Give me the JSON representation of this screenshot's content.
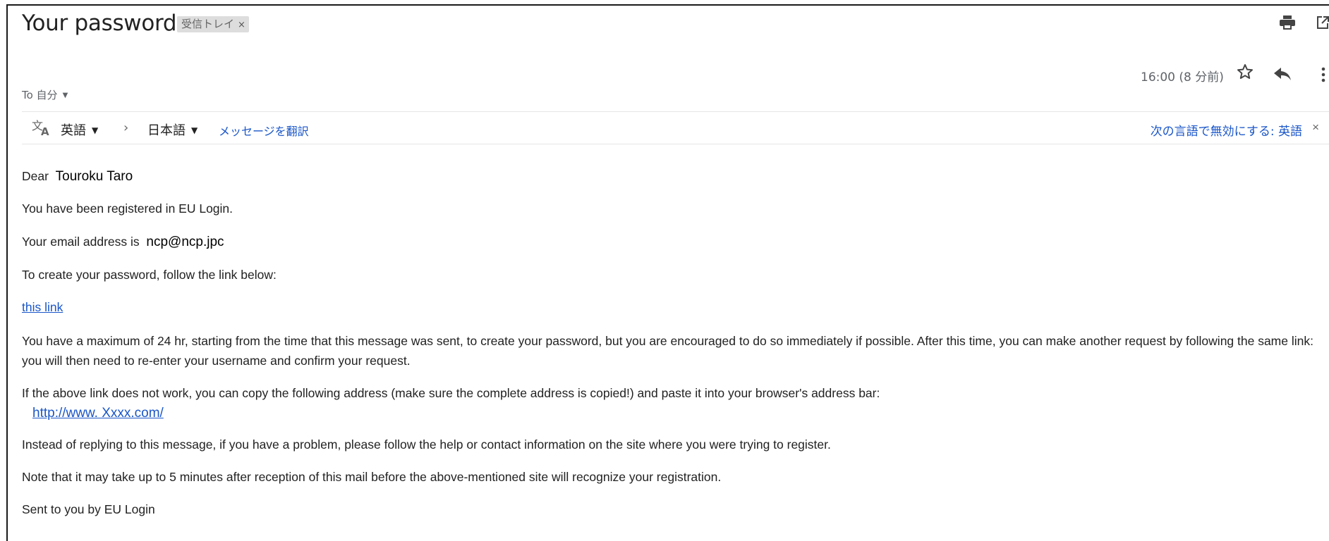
{
  "email": {
    "subject": "Your password",
    "label": "受信トレイ",
    "label_close": "×",
    "time": "16:00 (8 分前)",
    "to_label": "To 自分"
  },
  "translate": {
    "from_language": "英語",
    "to_language": "日本語",
    "translate_link": "メッセージを翻訳",
    "disable_link": "次の言語で無効にする: 英語",
    "close": "×"
  },
  "body": {
    "greeting": "Dear",
    "recipient_name": "Touroku Taro",
    "registered": "You have been registered in EU Login.",
    "email_prefix": "Your email address is",
    "email_address": "ncp@ncp.jpc",
    "create_instruction": "To create your password, follow the link below:",
    "link_text": "this link",
    "time_limit": "You have a maximum of 24 hr, starting from the time that this message was sent, to create your password, but you are encouraged to do so immediately if possible. After this time, you can make another request by following the same link: you will then need to re-enter your username and confirm your request.",
    "copy_instruction": "If the above link does not work, you can copy the following address (make sure the complete address is copied!) and paste it into your browser's address bar:",
    "url": "http://www. Xxxx.com/",
    "help_text": "Instead of replying to this message, if you have a problem, please follow the help or contact information on the site where you were trying to register.",
    "delay_note": "Note that it may take up to 5 minutes after reception of this mail before the above-mentioned site will recognize your registration.",
    "signature": "Sent to you by EU Login"
  },
  "icons": [
    "print-icon",
    "open-in-new-icon",
    "star-icon",
    "reply-icon",
    "more-vert-icon",
    "translate-icon"
  ],
  "colors": {
    "link": "#1a56c8",
    "chip": "#dddddd",
    "icon": "#5f6368"
  }
}
